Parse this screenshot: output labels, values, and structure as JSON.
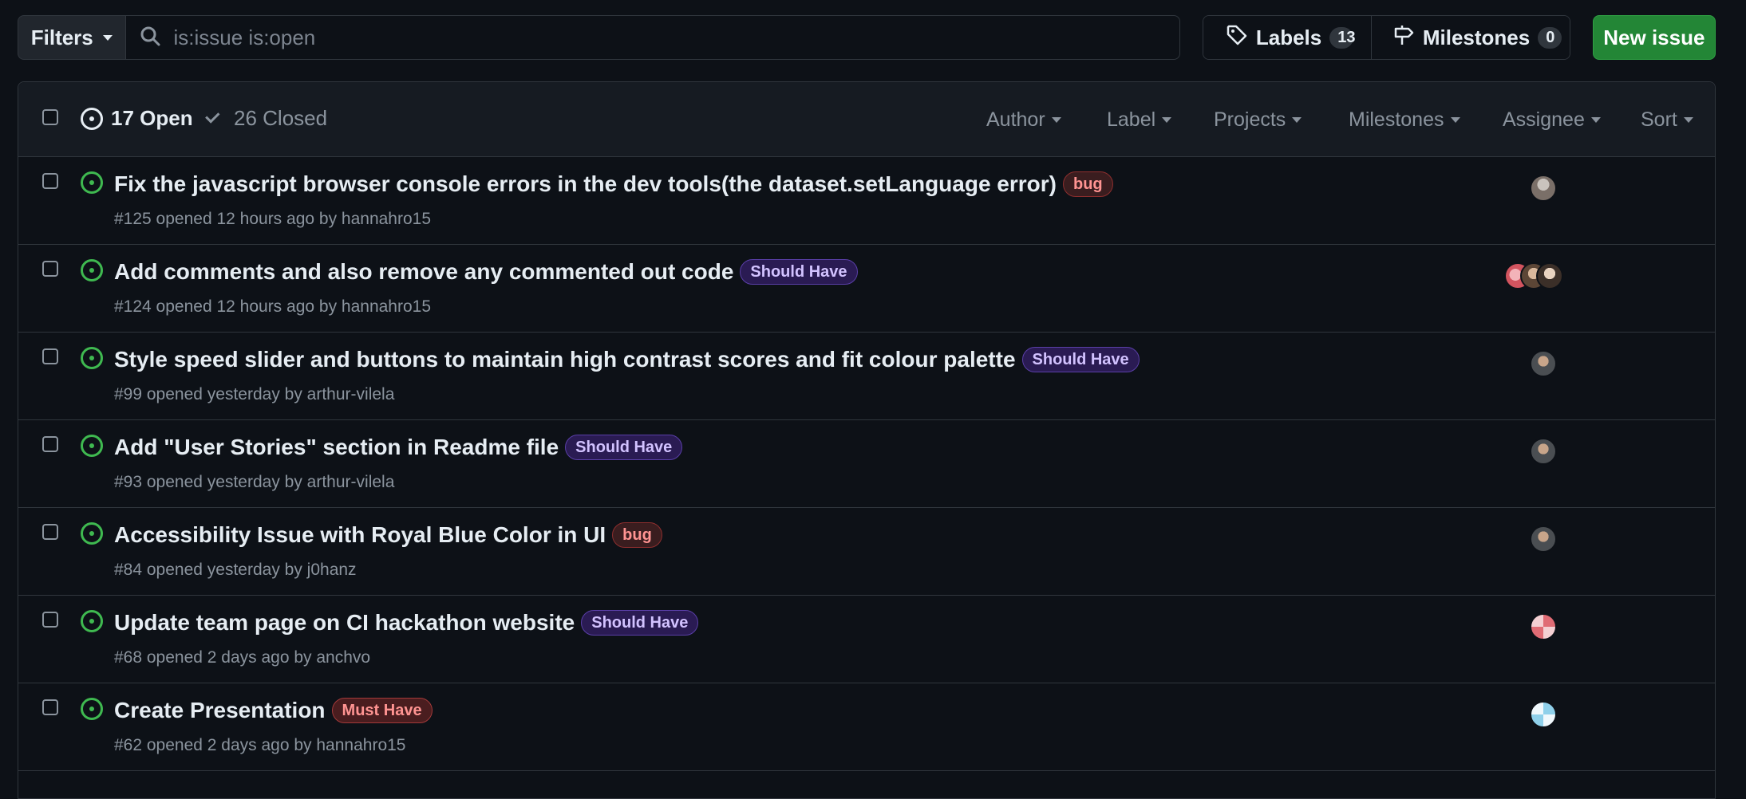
{
  "topbar": {
    "filters_label": "Filters",
    "search_placeholder": "is:issue is:open",
    "labels_label": "Labels",
    "labels_count": "13",
    "milestones_label": "Milestones",
    "milestones_count": "0",
    "new_issue_label": "New issue"
  },
  "header": {
    "open_label": "17 Open",
    "closed_label": "26 Closed",
    "menus": [
      "Author",
      "Label",
      "Projects",
      "Milestones",
      "Assignee",
      "Sort"
    ]
  },
  "issues": [
    {
      "title": "Fix the javascript browser console errors in the dev tools(the dataset.setLanguage error)",
      "label": "bug",
      "meta": "#125 opened 12 hours ago by hannahro15"
    },
    {
      "title": "Add comments and also remove any commented out code",
      "label": "Should Have",
      "meta": "#124 opened 12 hours ago by hannahro15"
    },
    {
      "title": "Style speed slider and buttons to maintain high contrast scores and fit colour palette",
      "label": "Should Have",
      "meta": "#99 opened yesterday by arthur-vilela"
    },
    {
      "title": "Add \"User Stories\" section in Readme file",
      "label": "Should Have",
      "meta": "#93 opened yesterday by arthur-vilela"
    },
    {
      "title": "Accessibility Issue with Royal Blue Color in UI",
      "label": "bug",
      "meta": "#84 opened yesterday by j0hanz"
    },
    {
      "title": "Update team page on CI hackathon website",
      "label": "Should Have",
      "meta": "#68 opened 2 days ago by anchvo"
    },
    {
      "title": "Create Presentation",
      "label": "Must Have",
      "meta": "#62 opened 2 days ago by hannahro15"
    }
  ],
  "colors": {
    "background": "#0d1117",
    "header_bg": "#161b22",
    "border": "#30363d",
    "open_green": "#3fb950",
    "new_issue_green": "#238636"
  }
}
